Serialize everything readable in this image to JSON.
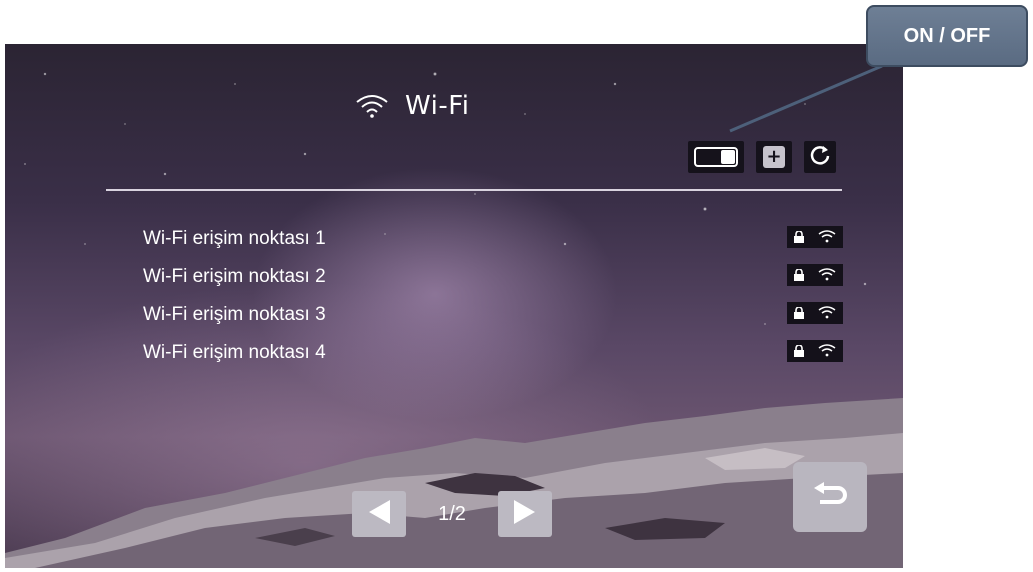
{
  "header": {
    "title": "Wi-Fi",
    "icon": "wifi-icon"
  },
  "controls": {
    "toggle_state": "on",
    "add_icon_glyph": "+",
    "refresh_icon": "refresh-icon"
  },
  "access_points": [
    {
      "label": "Wi-Fi erişim noktası 1",
      "locked": true,
      "icon": "wifi-signal-icon"
    },
    {
      "label": "Wi-Fi erişim noktası 2",
      "locked": true,
      "icon": "wifi-signal-icon"
    },
    {
      "label": "Wi-Fi erişim noktası 3",
      "locked": true,
      "icon": "wifi-signal-icon"
    },
    {
      "label": "Wi-Fi erişim noktası 4",
      "locked": true,
      "icon": "wifi-signal-icon"
    }
  ],
  "pagination": {
    "indicator": "1/2"
  },
  "callout": {
    "text": "ON / OFF"
  },
  "colors": {
    "callout_fill": "#5f7088",
    "button_gray": "#bcb9c2"
  }
}
